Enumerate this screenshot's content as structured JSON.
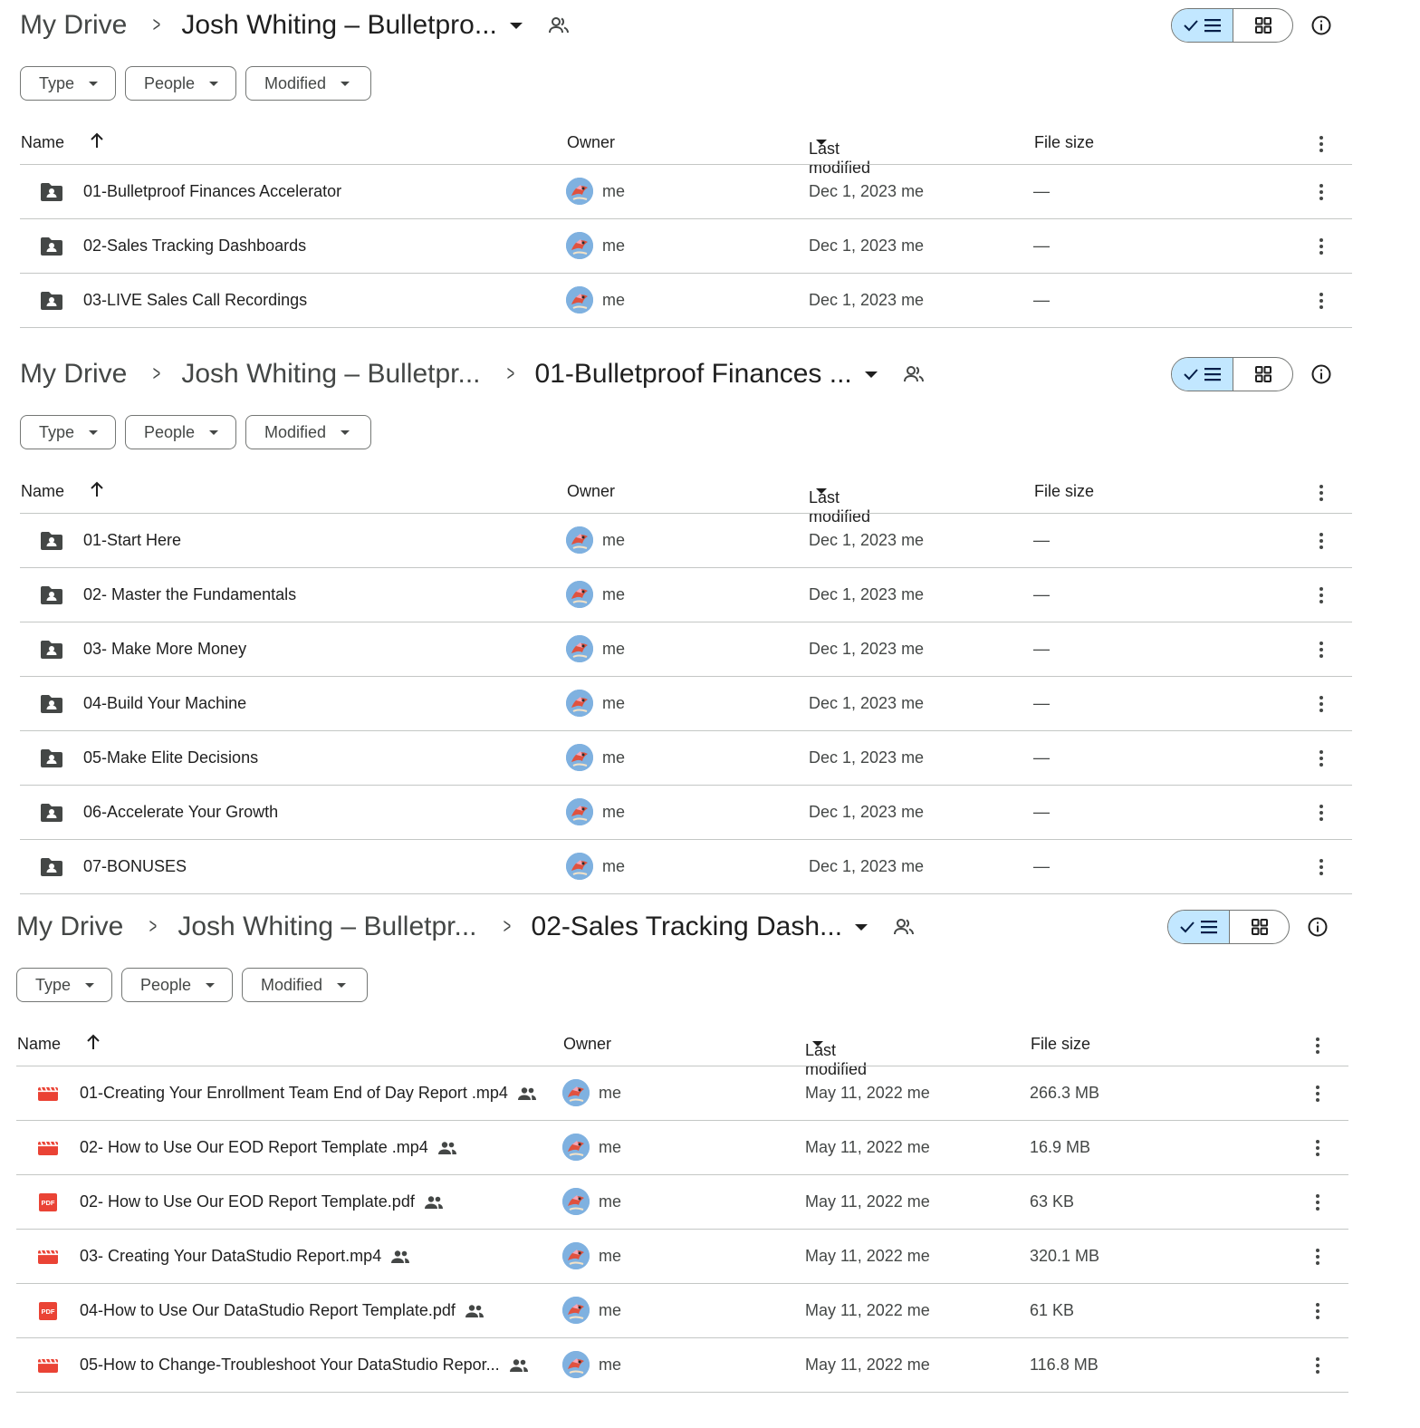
{
  "panels": [
    {
      "breadcrumb": {
        "root": "My Drive",
        "mid": "",
        "current": "Josh Whiting – Bulletpro..."
      },
      "filters": {
        "type": "Type",
        "people": "People",
        "modified": "Modified"
      },
      "columns": {
        "name": "Name",
        "owner": "Owner",
        "last_modified": "Last modified",
        "file_size": "File size"
      },
      "rows": [
        {
          "icon": "folder-icon",
          "name": "01-Bulletproof Finances Accelerator",
          "shared": false,
          "owner": "me",
          "modified": "Dec 1, 2023 me",
          "size": "—"
        },
        {
          "icon": "folder-icon",
          "name": "02-Sales Tracking Dashboards",
          "shared": false,
          "owner": "me",
          "modified": "Dec 1, 2023 me",
          "size": "—"
        },
        {
          "icon": "folder-icon",
          "name": "03-LIVE Sales Call Recordings",
          "shared": false,
          "owner": "me",
          "modified": "Dec 1, 2023 me",
          "size": "—"
        }
      ]
    },
    {
      "breadcrumb": {
        "root": "My Drive",
        "mid": "Josh Whiting – Bulletpr...",
        "current": "01-Bulletproof Finances ..."
      },
      "filters": {
        "type": "Type",
        "people": "People",
        "modified": "Modified"
      },
      "columns": {
        "name": "Name",
        "owner": "Owner",
        "last_modified": "Last modified",
        "file_size": "File size"
      },
      "rows": [
        {
          "icon": "folder-icon",
          "name": "01-Start Here",
          "shared": false,
          "owner": "me",
          "modified": "Dec 1, 2023 me",
          "size": "—"
        },
        {
          "icon": "folder-icon",
          "name": "02- Master the Fundamentals",
          "shared": false,
          "owner": "me",
          "modified": "Dec 1, 2023 me",
          "size": "—"
        },
        {
          "icon": "folder-icon",
          "name": "03- Make More Money",
          "shared": false,
          "owner": "me",
          "modified": "Dec 1, 2023 me",
          "size": "—"
        },
        {
          "icon": "folder-icon",
          "name": "04-Build Your Machine",
          "shared": false,
          "owner": "me",
          "modified": "Dec 1, 2023 me",
          "size": "—"
        },
        {
          "icon": "folder-icon",
          "name": "05-Make Elite Decisions",
          "shared": false,
          "owner": "me",
          "modified": "Dec 1, 2023 me",
          "size": "—"
        },
        {
          "icon": "folder-icon",
          "name": "06-Accelerate Your Growth",
          "shared": false,
          "owner": "me",
          "modified": "Dec 1, 2023 me",
          "size": "—"
        },
        {
          "icon": "folder-icon",
          "name": "07-BONUSES",
          "shared": false,
          "owner": "me",
          "modified": "Dec 1, 2023 me",
          "size": "—"
        }
      ]
    },
    {
      "breadcrumb": {
        "root": "My Drive",
        "mid": "Josh Whiting – Bulletpr...",
        "current": "02-Sales Tracking Dash..."
      },
      "filters": {
        "type": "Type",
        "people": "People",
        "modified": "Modified"
      },
      "columns": {
        "name": "Name",
        "owner": "Owner",
        "last_modified": "Last modified",
        "file_size": "File size"
      },
      "rows": [
        {
          "icon": "video-icon",
          "name": "01-Creating Your Enrollment Team End of Day Report .mp4",
          "shared": true,
          "owner": "me",
          "modified": "May 11, 2022 me",
          "size": "266.3 MB"
        },
        {
          "icon": "video-icon",
          "name": "02- How to Use Our EOD Report Template .mp4",
          "shared": true,
          "owner": "me",
          "modified": "May 11, 2022 me",
          "size": "16.9 MB"
        },
        {
          "icon": "pdf-icon",
          "name": "02- How to Use Our EOD Report Template.pdf",
          "shared": true,
          "owner": "me",
          "modified": "May 11, 2022 me",
          "size": "63 KB"
        },
        {
          "icon": "video-icon",
          "name": "03- Creating Your DataStudio Report.mp4",
          "shared": true,
          "owner": "me",
          "modified": "May 11, 2022 me",
          "size": "320.1 MB"
        },
        {
          "icon": "pdf-icon",
          "name": "04-How to Use Our DataStudio Report Template.pdf",
          "shared": true,
          "owner": "me",
          "modified": "May 11, 2022 me",
          "size": "61 KB"
        },
        {
          "icon": "video-icon",
          "name": "05-How to Change-Troubleshoot Your DataStudio Repor...",
          "shared": true,
          "owner": "me",
          "modified": "May 11, 2022 me",
          "size": "116.8 MB"
        }
      ]
    }
  ],
  "colors": {
    "accent": "#c2e7ff",
    "border": "#747775",
    "divider": "#c4c7c5",
    "video": "#ea4335",
    "pdf": "#ea4335",
    "folder": "#444746"
  },
  "icons": {
    "pdf_label": "PDF"
  }
}
